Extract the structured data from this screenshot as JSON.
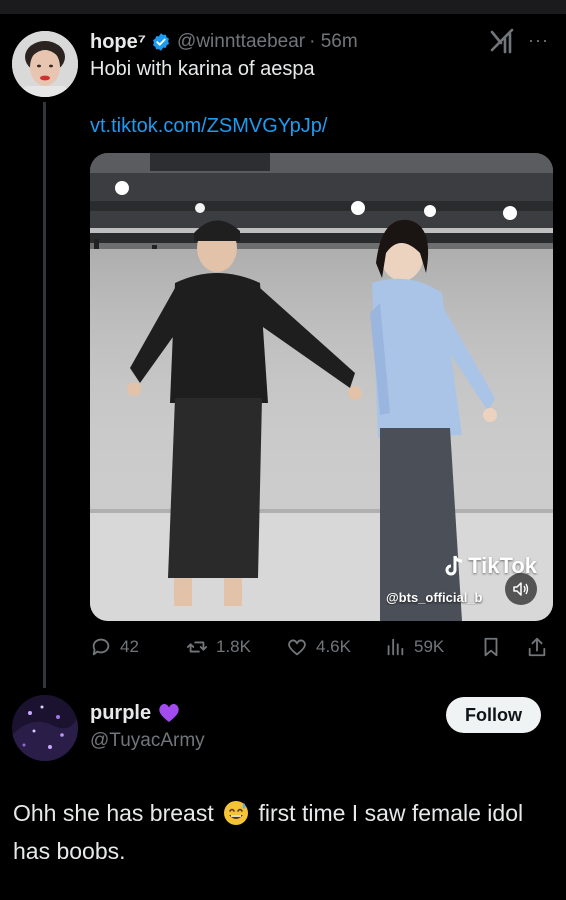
{
  "tweet": {
    "display_name": "hope⁷",
    "handle": "@winnttaebear",
    "time": "· 56m",
    "text": "Hobi with karina of aespa",
    "link": "vt.tiktok.com/ZSMVGYpJp/",
    "media": {
      "watermark": "TikTok",
      "watermark_handle": "@bts_official_b"
    },
    "stats": {
      "replies": "42",
      "reposts": "1.8K",
      "likes": "4.6K",
      "views": "59K"
    },
    "icons": [
      "verified-badge-icon",
      "grok-icon",
      "more-icon",
      "reply-icon",
      "repost-icon",
      "like-icon",
      "views-icon",
      "bookmark-icon",
      "share-icon",
      "mute-icon"
    ]
  },
  "reply": {
    "display_name": "purple",
    "handle": "@TuyacArmy",
    "follow_label": "Follow",
    "text_before_emoji": "Ohh she has breast",
    "text_after_emoji": "first time I saw female idol has boobs.",
    "icons": [
      "purple-heart-emoji",
      "sweat-smile-emoji"
    ]
  },
  "colors": {
    "background": "#000000",
    "text": "#e7e9ea",
    "muted": "#71767b",
    "link": "#1d9bf0",
    "verified": "#1d9bf0",
    "follow_bg": "#eff3f4"
  }
}
